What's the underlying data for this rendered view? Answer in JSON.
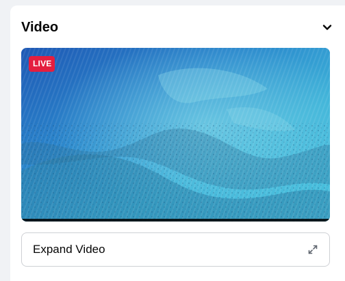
{
  "panel": {
    "title": "Video",
    "collapse_icon": "chevron-down-icon"
  },
  "video": {
    "live_badge": "LIVE",
    "scene": "aerial ocean reef",
    "colors": {
      "deep_water": "#1f5fb5",
      "shallow_water": "#38b6d6",
      "reef": "#2f7fa5",
      "live_badge": "#e41e3f"
    }
  },
  "expand": {
    "label": "Expand Video",
    "icon": "expand-arrows-icon"
  }
}
